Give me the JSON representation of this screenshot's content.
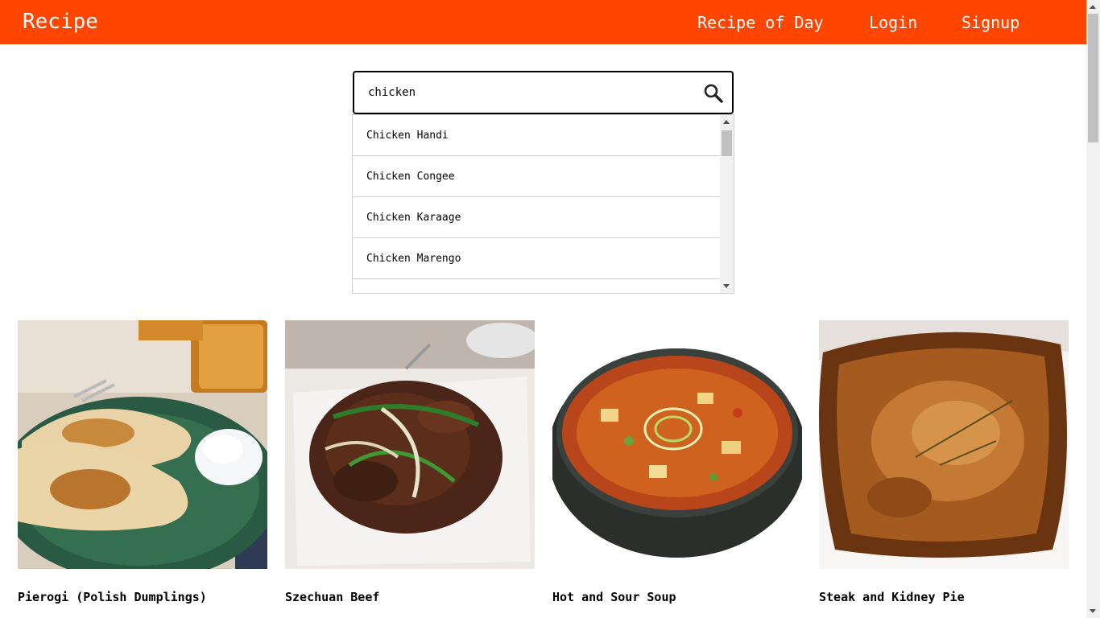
{
  "header": {
    "brand": "Recipe",
    "nav": [
      "Recipe of Day",
      "Login",
      "Signup"
    ],
    "color": "#ff4500"
  },
  "search": {
    "value": "chicken",
    "icon": "search-icon",
    "suggestions": [
      "Chicken Handi",
      "Chicken Congee",
      "Chicken Karaage",
      "Chicken Marengo"
    ]
  },
  "recipes": [
    {
      "title": "Pierogi (Polish Dumplings)"
    },
    {
      "title": "Szechuan Beef"
    },
    {
      "title": "Hot and Sour Soup"
    },
    {
      "title": "Steak and Kidney Pie"
    }
  ]
}
